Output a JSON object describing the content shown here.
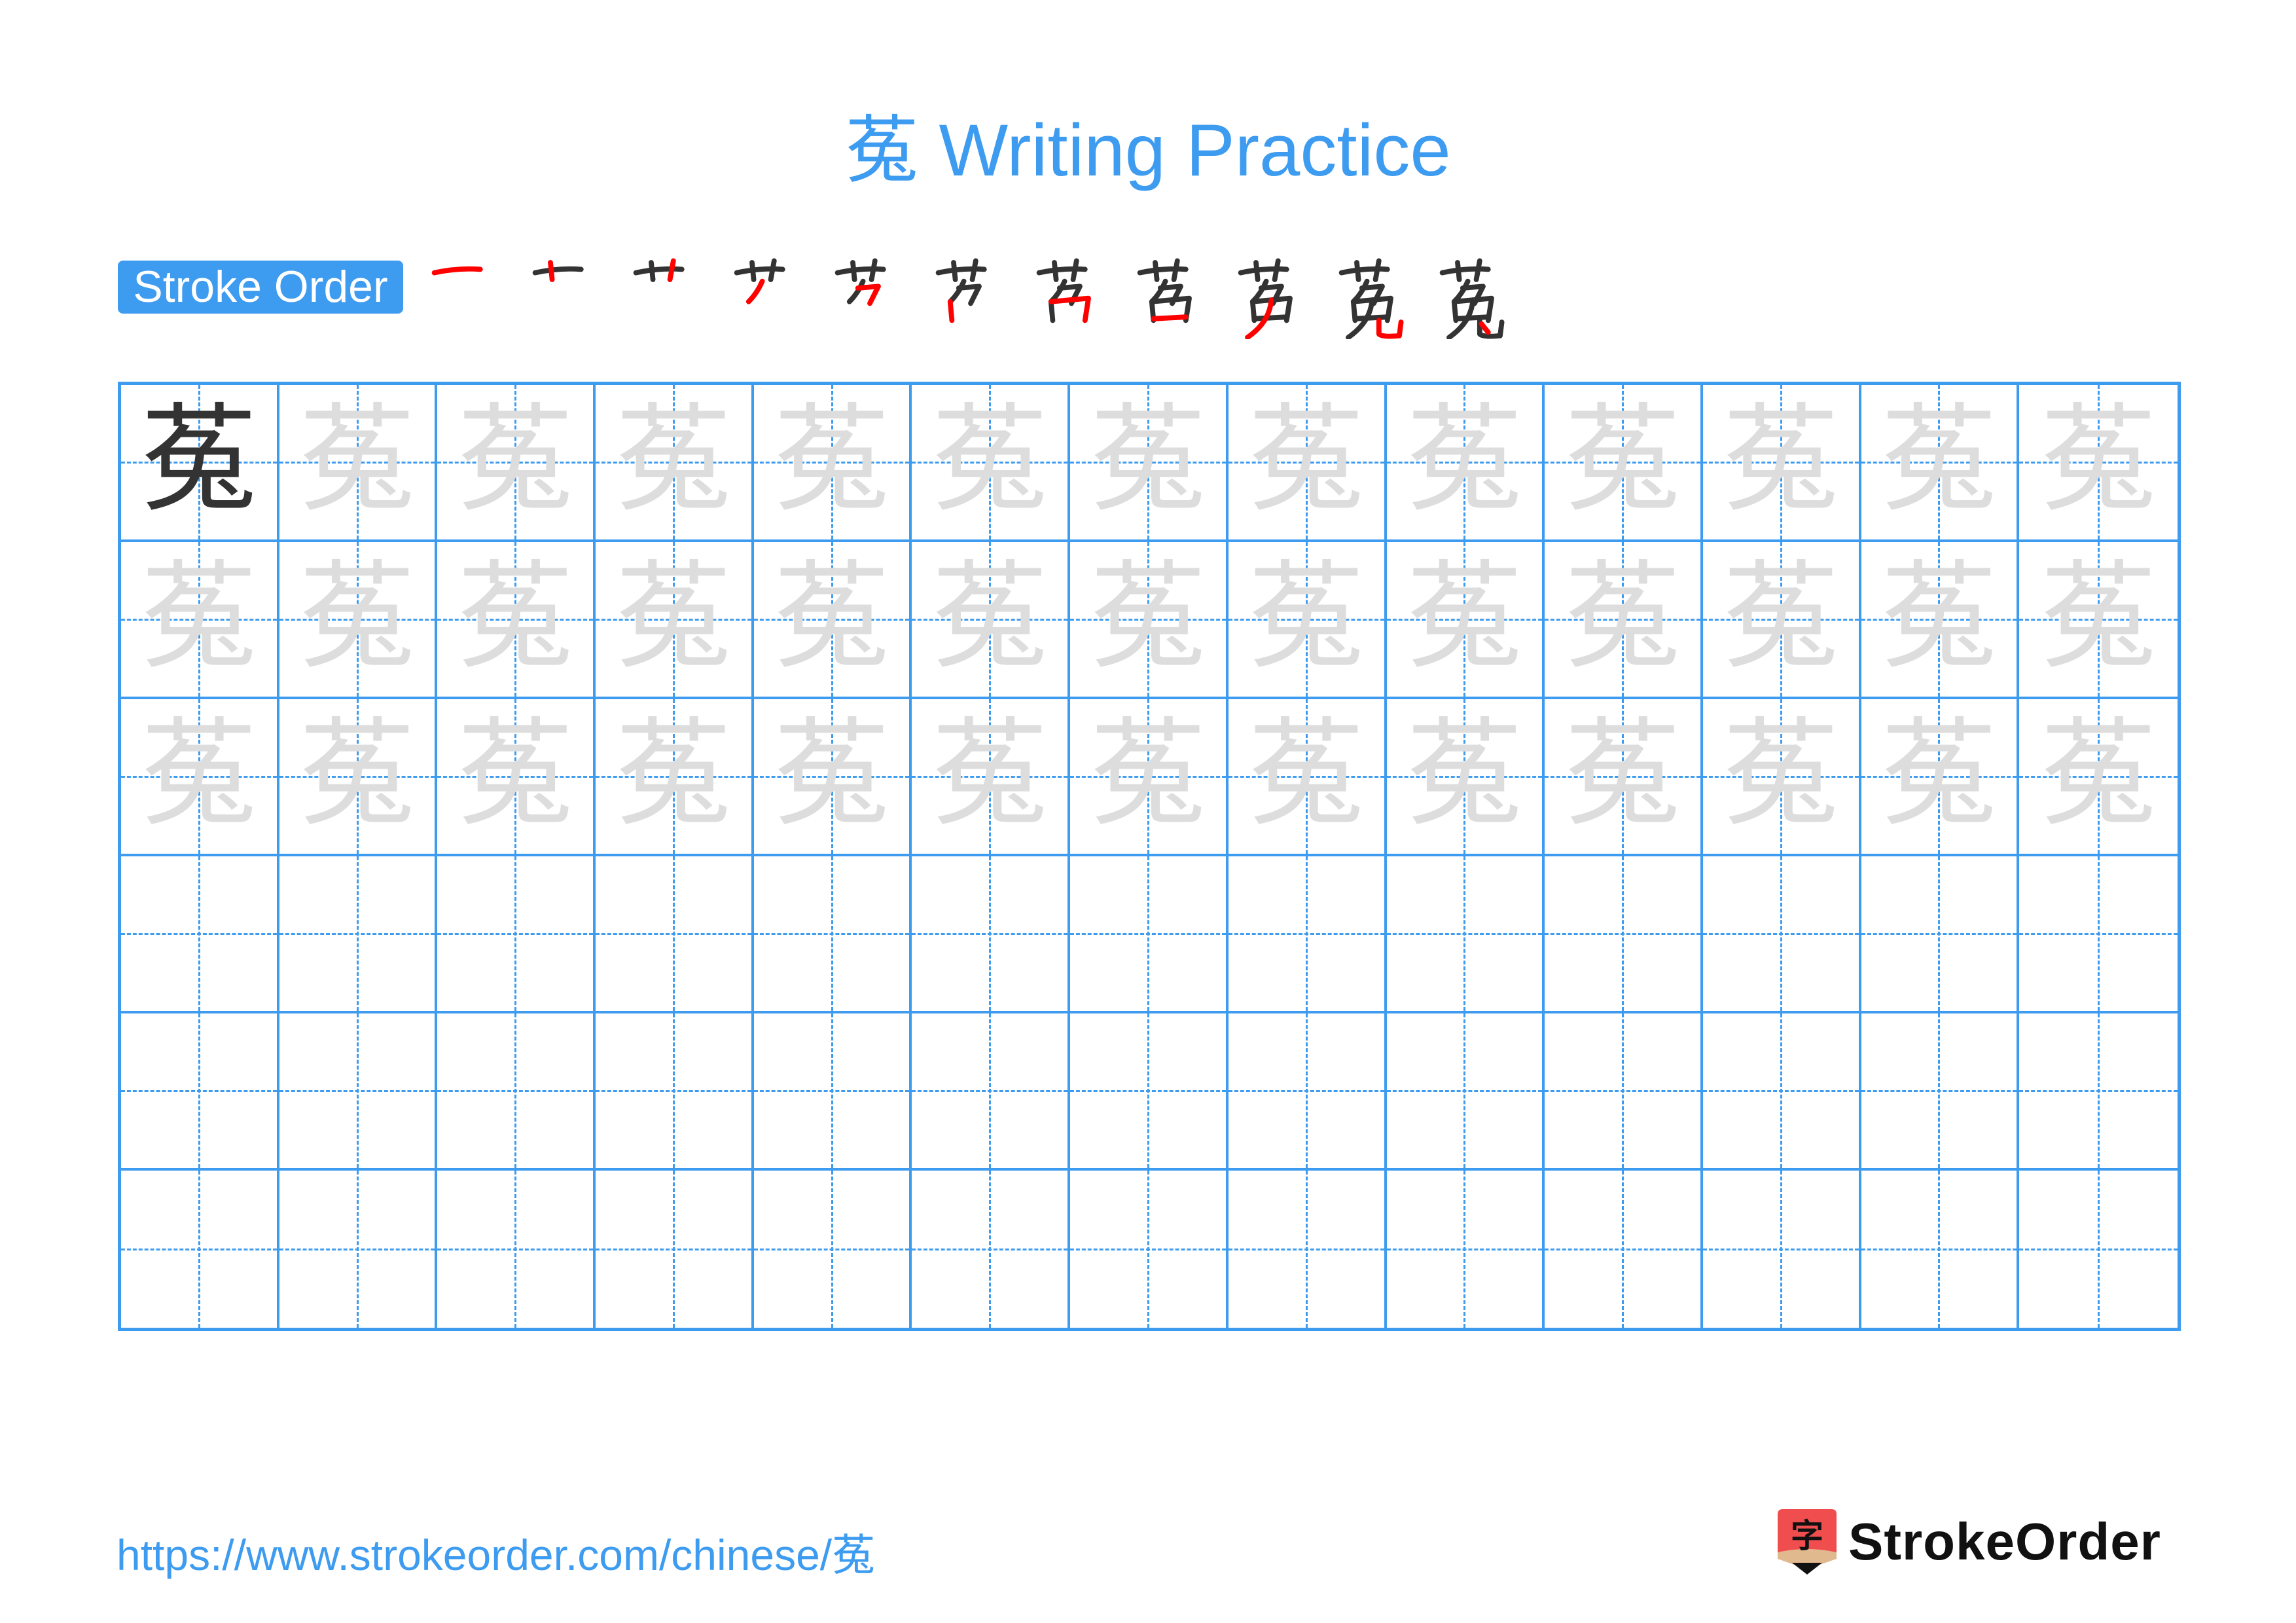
{
  "title": "菟 Writing Practice",
  "character": "菟",
  "stroke_order": {
    "label": "Stroke Order",
    "stroke_count": 11,
    "steps": [
      {
        "step": 1,
        "partial": "一",
        "highlight": "first horizontal"
      },
      {
        "step": 2,
        "partial": "十",
        "highlight": "left vertical"
      },
      {
        "step": 3,
        "partial": "艹",
        "highlight": "right vertical"
      },
      {
        "step": 4,
        "partial": "艹丿",
        "highlight": "left-falling"
      },
      {
        "step": 5,
        "partial": "艹⺈",
        "highlight": "horizontal hook"
      },
      {
        "step": 6,
        "partial": "艹⺈丨",
        "highlight": "short vertical"
      },
      {
        "step": 7,
        "partial": "艹⺈冂",
        "highlight": "horizontal-fold"
      },
      {
        "step": 8,
        "partial": "艹⺈口",
        "highlight": "bottom horizontal"
      },
      {
        "step": 9,
        "partial": "艹⺈口丿",
        "highlight": "long left-falling"
      },
      {
        "step": 10,
        "partial": "菟 (no dot)",
        "highlight": "vertical-bend-hook"
      },
      {
        "step": 11,
        "partial": "菟",
        "highlight": "dot"
      }
    ],
    "colors": {
      "highlight": "#ff0000",
      "done": "#333333"
    }
  },
  "grid": {
    "rows": 6,
    "cols": 13,
    "model_cells": 1,
    "trace_rows": 3,
    "blank_rows": 3,
    "line_color": "#3d9bf0",
    "model_color": "#333333",
    "trace_color": "#dddddd"
  },
  "footer": {
    "url": "https://www.strokeorder.com/chinese/菟",
    "brand": "StrokeOrder",
    "logo_glyph": "字",
    "logo_colors": {
      "body": "#f04e4e",
      "band": "#e0b98f",
      "tip": "#111111"
    }
  }
}
